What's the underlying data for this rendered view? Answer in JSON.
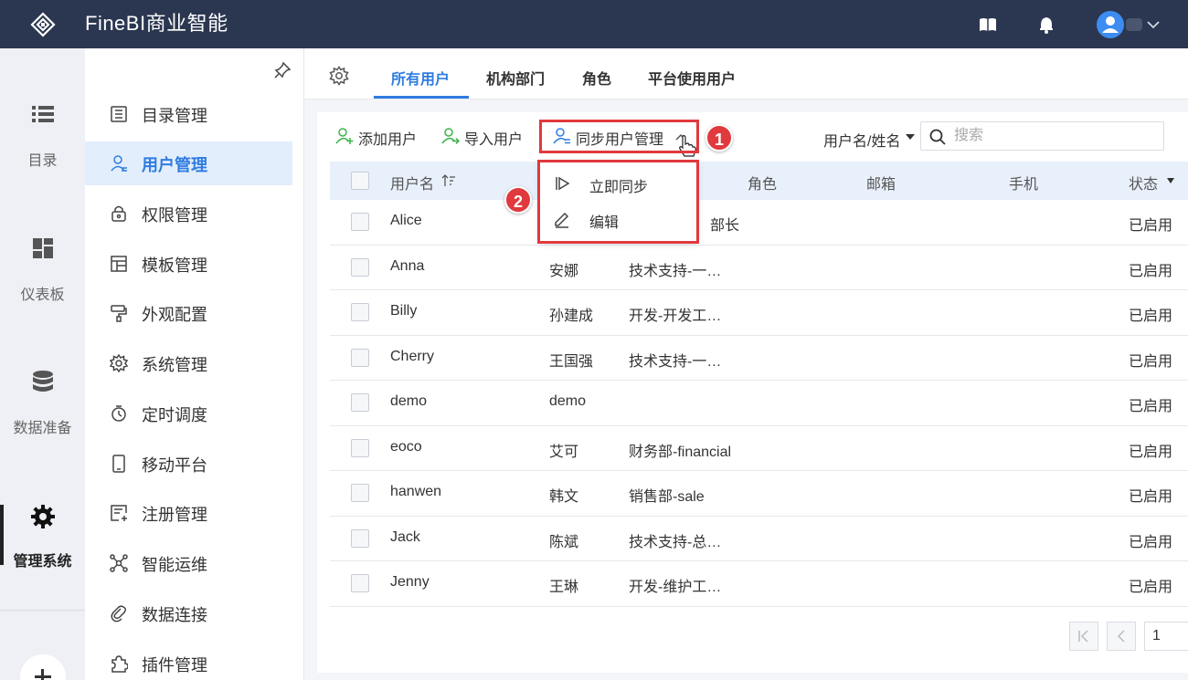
{
  "app": {
    "title": "FineBI商业智能"
  },
  "rail": {
    "items": [
      {
        "label": "目录",
        "icon": "list-icon"
      },
      {
        "label": "仪表板",
        "icon": "dashboard-icon"
      },
      {
        "label": "数据准备",
        "icon": "database-icon"
      },
      {
        "label": "管理系统",
        "icon": "gear-icon",
        "active": true
      }
    ],
    "add_icon": "plus-icon"
  },
  "submenu": {
    "items": [
      {
        "label": "目录管理",
        "icon": "directory-icon"
      },
      {
        "label": "用户管理",
        "icon": "user-icon",
        "active": true
      },
      {
        "label": "权限管理",
        "icon": "lock-icon"
      },
      {
        "label": "模板管理",
        "icon": "template-icon"
      },
      {
        "label": "外观配置",
        "icon": "paint-roller-icon"
      },
      {
        "label": "系统管理",
        "icon": "gear-icon"
      },
      {
        "label": "定时调度",
        "icon": "timer-icon"
      },
      {
        "label": "移动平台",
        "icon": "mobile-icon"
      },
      {
        "label": "注册管理",
        "icon": "register-icon"
      },
      {
        "label": "智能运维",
        "icon": "network-icon"
      },
      {
        "label": "数据连接",
        "icon": "link-icon"
      },
      {
        "label": "插件管理",
        "icon": "puzzle-icon"
      }
    ]
  },
  "tabs": [
    {
      "label": "所有用户",
      "active": true
    },
    {
      "label": "机构部门"
    },
    {
      "label": "角色"
    },
    {
      "label": "平台使用用户"
    }
  ],
  "toolbar": {
    "add_user": "添加用户",
    "import_user": "导入用户",
    "sync_manage": "同步用户管理",
    "filter_label": "用户名/姓名",
    "search_placeholder": "搜索"
  },
  "badges": {
    "one": "1",
    "two": "2"
  },
  "dropdown": {
    "items": [
      {
        "label": "立即同步",
        "icon": "play-icon"
      },
      {
        "label": "编辑",
        "icon": "edit-icon"
      }
    ]
  },
  "table": {
    "headers": {
      "username": "用户名",
      "role": "角色",
      "email": "邮箱",
      "phone": "手机",
      "status": "状态"
    },
    "rows": [
      {
        "username": "Alice",
        "name": "",
        "role": "部长",
        "status": "已启用"
      },
      {
        "username": "Anna",
        "name": "安娜",
        "role": "技术支持-一…",
        "status": "已启用"
      },
      {
        "username": "Billy",
        "name": "孙建成",
        "role": "开发-开发工…",
        "status": "已启用"
      },
      {
        "username": "Cherry",
        "name": "王国强",
        "role": "技术支持-一…",
        "status": "已启用"
      },
      {
        "username": "demo",
        "name": "demo",
        "role": "",
        "status": "已启用"
      },
      {
        "username": "eoco",
        "name": "艾可",
        "role": "财务部-financial",
        "status": "已启用"
      },
      {
        "username": "hanwen",
        "name": "韩文",
        "role": "销售部-sale",
        "status": "已启用"
      },
      {
        "username": "Jack",
        "name": "陈斌",
        "role": "技术支持-总…",
        "status": "已启用"
      },
      {
        "username": "Jenny",
        "name": "王琳",
        "role": "开发-维护工…",
        "status": "已启用"
      }
    ]
  },
  "pagination": {
    "page": "1"
  },
  "colors": {
    "topbar": "#2b3750",
    "accent": "#2f7ce0",
    "highlight": "#e0393e",
    "green": "#3bb34a"
  }
}
